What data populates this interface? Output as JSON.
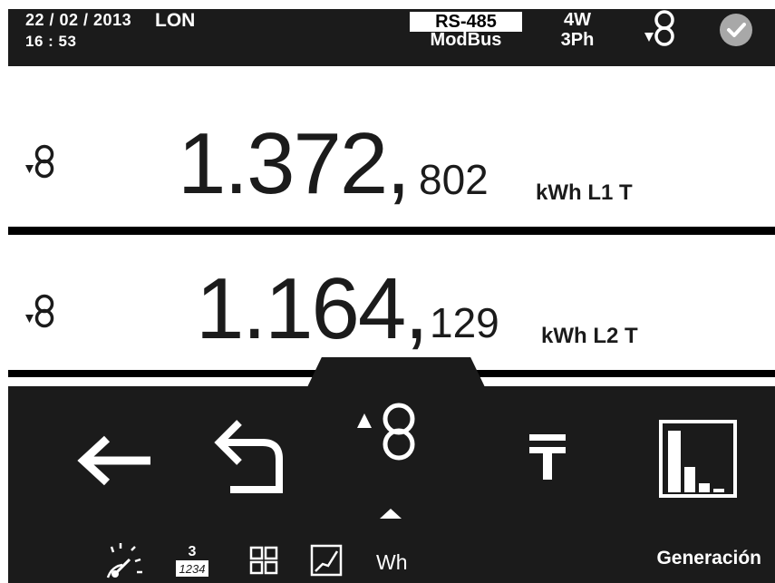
{
  "status": {
    "date": "22 / 02 / 2013",
    "time": "16 : 53",
    "location": "LON",
    "protocol": "RS-485",
    "mode": "ModBus",
    "wires": "4W",
    "phases": "3Ph",
    "ct_icon": "current-transformer-icon",
    "check_icon": "check-icon"
  },
  "readings": [
    {
      "integer": "1.372,",
      "decimal": "802",
      "unit": "kWh L1 T"
    },
    {
      "integer": "1.164,",
      "decimal": "129",
      "unit": "kWh L2 T"
    }
  ],
  "toolbar": {
    "buttons": [
      "arrow-left-icon",
      "return-icon",
      "current-transformer-icon",
      "tariff-icon",
      "bar-chart-icon"
    ],
    "selected": "current-transformer-icon"
  },
  "bottom": {
    "icons": [
      "gauge-icon",
      "counter-icon",
      "grid-icon",
      "graph-icon"
    ],
    "counter_top": "3",
    "counter_bottom": "1234",
    "wh_label": "Wh",
    "mode_label": "Generación"
  },
  "colors": {
    "dark": "#1b1b1b",
    "check": "#a8a8a8"
  }
}
